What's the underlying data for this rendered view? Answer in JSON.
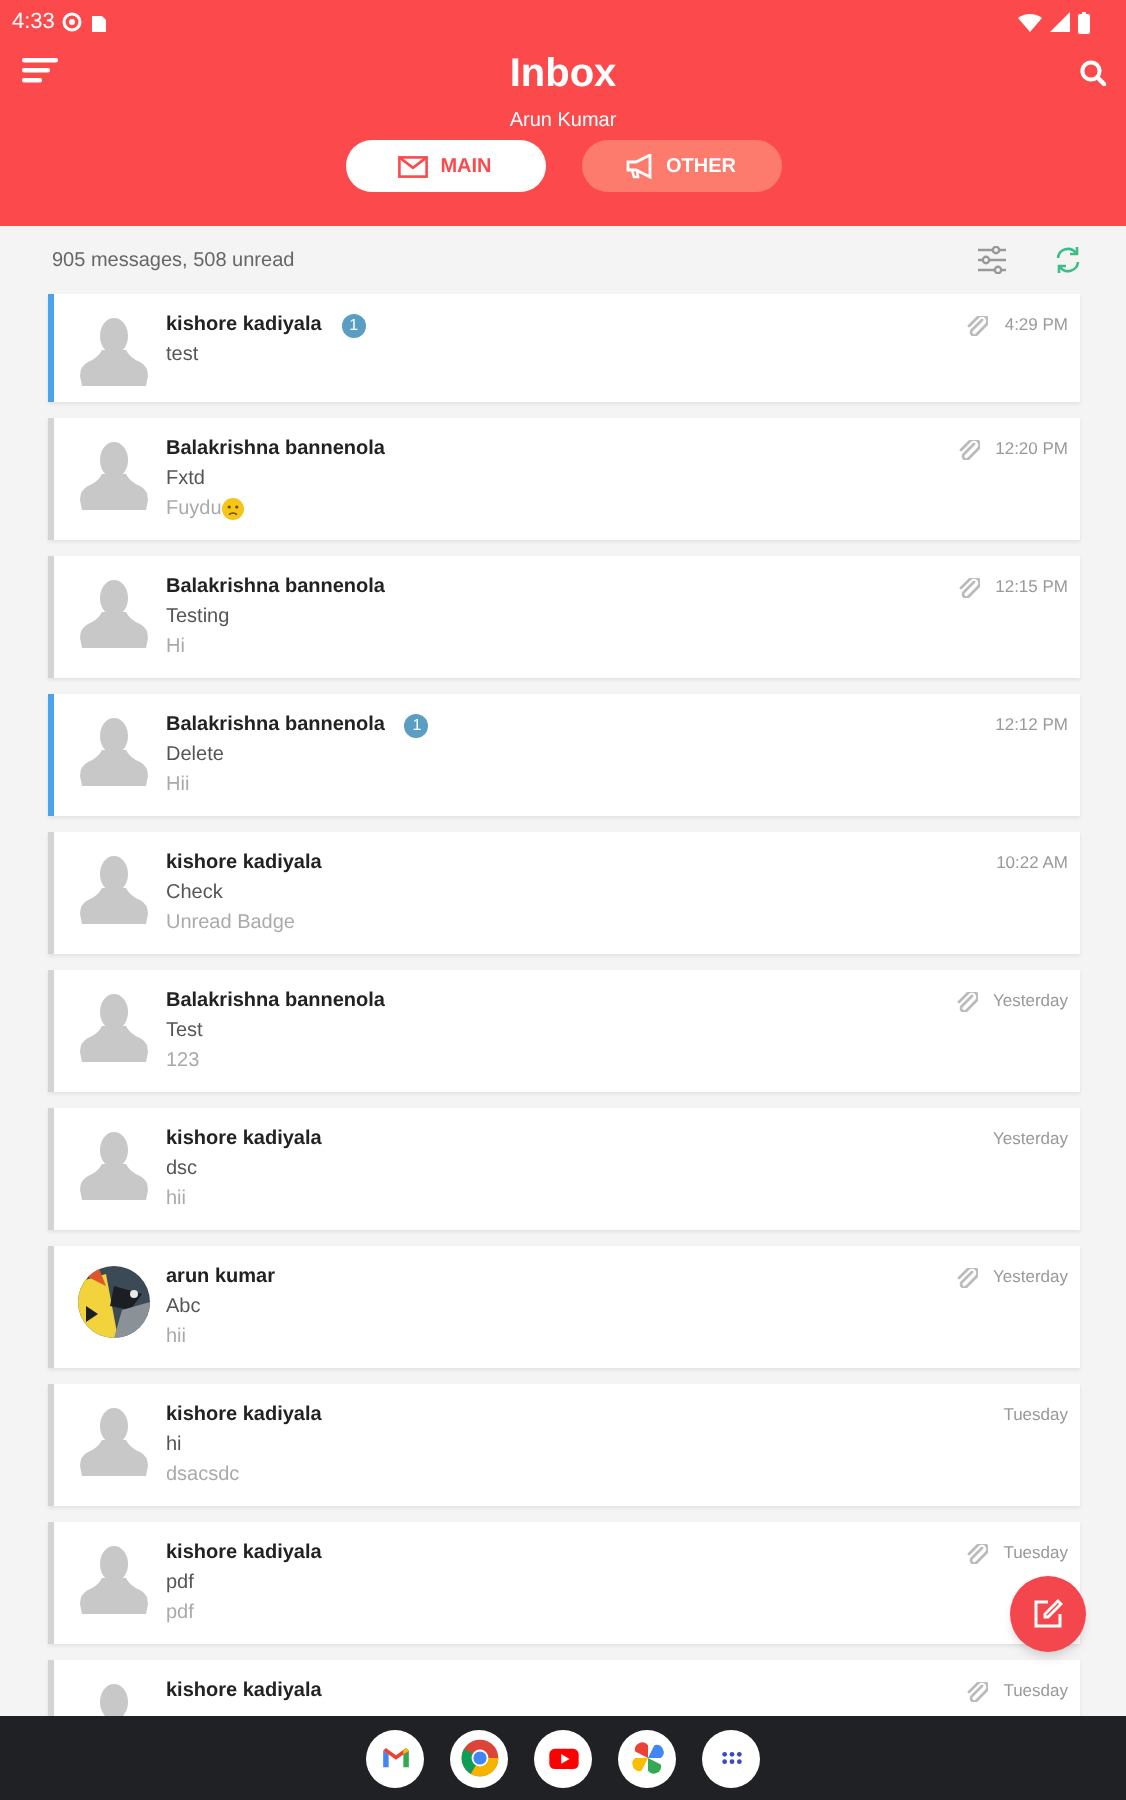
{
  "status_bar": {
    "time": "4:33"
  },
  "header": {
    "title": "Inbox",
    "subtitle": "Arun Kumar"
  },
  "tabs": [
    {
      "label": "MAIN",
      "selected": true,
      "kind": "mail"
    },
    {
      "label": "OTHER",
      "selected": false,
      "kind": "megaphone"
    }
  ],
  "summary": "905 messages, 508 unread",
  "messages": [
    {
      "sender": "kishore kadiyala",
      "subject": "test",
      "unread": true,
      "badge": "1",
      "attachment": true,
      "time": "4:29 PM",
      "photo": false
    },
    {
      "sender": "Balakrishna bannenola",
      "subject": "Fxtd",
      "preview": "Fuydu",
      "preview_emoji": true,
      "unread": false,
      "attachment": true,
      "time": "12:20 PM",
      "photo": false
    },
    {
      "sender": "Balakrishna bannenola",
      "subject": "Testing",
      "preview": "Hi",
      "unread": false,
      "attachment": true,
      "time": "12:15 PM",
      "photo": false
    },
    {
      "sender": "Balakrishna bannenola",
      "subject": "Delete",
      "preview": "Hii",
      "unread": true,
      "badge": "1",
      "attachment": false,
      "time": "12:12 PM",
      "photo": false
    },
    {
      "sender": "kishore kadiyala",
      "subject": "Check",
      "preview": "Unread Badge",
      "unread": false,
      "attachment": false,
      "time": "10:22 AM",
      "photo": false
    },
    {
      "sender": "Balakrishna bannenola",
      "subject": "Test",
      "preview": "123",
      "unread": false,
      "attachment": true,
      "time": "Yesterday",
      "photo": false
    },
    {
      "sender": "kishore kadiyala",
      "subject": "dsc",
      "preview": "hii",
      "unread": false,
      "attachment": false,
      "time": "Yesterday",
      "photo": false
    },
    {
      "sender": "arun kumar",
      "subject": "Abc",
      "preview": "hii",
      "unread": false,
      "attachment": true,
      "time": "Yesterday",
      "photo": true
    },
    {
      "sender": "kishore kadiyala",
      "subject": "hi",
      "preview": "dsacsdc",
      "unread": false,
      "attachment": false,
      "time": "Tuesday",
      "photo": false
    },
    {
      "sender": "kishore kadiyala",
      "subject": "pdf",
      "preview": "pdf",
      "unread": false,
      "attachment": true,
      "time": "Tuesday",
      "photo": false
    },
    {
      "sender": "kishore kadiyala",
      "unread": false,
      "attachment": true,
      "time": "Tuesday",
      "photo": false
    }
  ],
  "dock": [
    {
      "kind": "gmail"
    },
    {
      "kind": "chrome"
    },
    {
      "kind": "youtube"
    },
    {
      "kind": "photos"
    },
    {
      "kind": "apps"
    }
  ]
}
